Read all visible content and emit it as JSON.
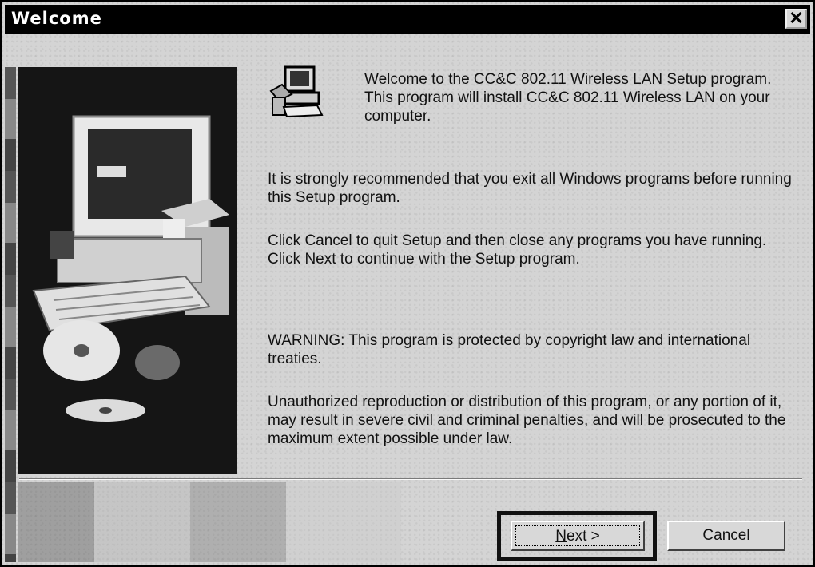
{
  "window": {
    "title": "Welcome",
    "close_symbol": "✕"
  },
  "icons": {
    "setup": "setup-computer-icon",
    "close": "close-icon"
  },
  "content": {
    "welcome": "Welcome to the CC&C 802.11 Wireless LAN Setup program.  This program will install CC&C 802.11 Wireless LAN on your computer.",
    "exit_advice": "It is strongly recommended that you exit all Windows programs before running this Setup program.",
    "cancel_advice": "Click Cancel to quit Setup and then close any programs you have running.  Click Next to continue with the Setup program.",
    "warning": "WARNING: This program is protected by copyright law and international treaties.",
    "unauthorized": "Unauthorized reproduction or distribution of this program, or any portion of it, may result in severe civil and criminal penalties, and will be prosecuted to the maximum extent possible under law."
  },
  "buttons": {
    "next_mnemonic": "N",
    "next_rest": "ext >",
    "cancel": "Cancel"
  }
}
